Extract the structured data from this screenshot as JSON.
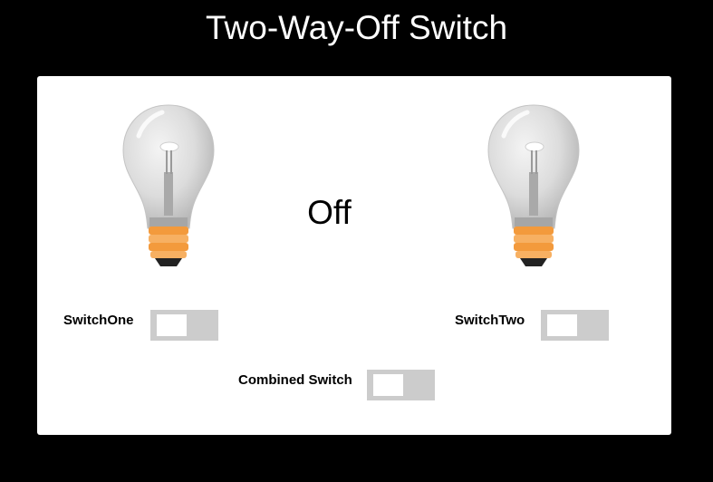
{
  "page": {
    "title": "Two-Way-Off Switch"
  },
  "status": {
    "text": "Off"
  },
  "bulbs": {
    "left": {
      "state": "off",
      "icon": "lightbulb-icon"
    },
    "right": {
      "state": "off",
      "icon": "lightbulb-icon"
    }
  },
  "switches": {
    "one": {
      "label": "SwitchOne",
      "checked": false
    },
    "two": {
      "label": "SwitchTwo",
      "checked": false
    },
    "combined": {
      "label": "Combined Switch",
      "checked": false
    }
  },
  "colors": {
    "background": "#000000",
    "panel": "#ffffff",
    "switch_track": "#cccccc",
    "switch_knob": "#ffffff",
    "bulb_base": "#f5a04a"
  }
}
